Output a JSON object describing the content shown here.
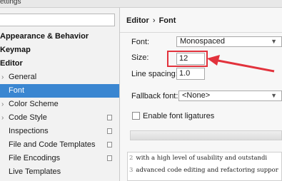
{
  "window": {
    "title": "ettings"
  },
  "sidebar": {
    "items": [
      {
        "label": "Appearance & Behavior",
        "type": "section"
      },
      {
        "label": "Keymap",
        "type": "section"
      },
      {
        "label": "Editor",
        "type": "section"
      },
      {
        "label": "General",
        "type": "child",
        "chevron": true
      },
      {
        "label": "Font",
        "type": "child",
        "selected": true
      },
      {
        "label": "Color Scheme",
        "type": "child",
        "chevron": true
      },
      {
        "label": "Code Style",
        "type": "child",
        "chevron": true,
        "copy_icon": true
      },
      {
        "label": "Inspections",
        "type": "child",
        "copy_icon": true
      },
      {
        "label": "File and Code Templates",
        "type": "child",
        "copy_icon": true
      },
      {
        "label": "File Encodings",
        "type": "child",
        "copy_icon": true
      },
      {
        "label": "Live Templates",
        "type": "child"
      }
    ],
    "chevron_glyph": "›"
  },
  "main": {
    "breadcrumb": {
      "parent": "Editor",
      "separator": "›",
      "current": "Font"
    },
    "font_label": "Font:",
    "font_value": "Monospaced",
    "size_label": "Size:",
    "size_value": "12",
    "line_spacing_label": "Line spacing:",
    "line_spacing_value": "1.0",
    "fallback_label": "Fallback font:",
    "fallback_value": "<None>",
    "ligatures_label": "Enable font ligatures",
    "combo_arrow": "▼",
    "preview_lines": [
      {
        "num": "2",
        "text": "with a high level of usability and outstandi"
      },
      {
        "num": "3",
        "text": "advanced code editing and refactoring suppor"
      }
    ]
  },
  "colors": {
    "selection": "#3a86d1",
    "highlight": "#e2323c"
  }
}
